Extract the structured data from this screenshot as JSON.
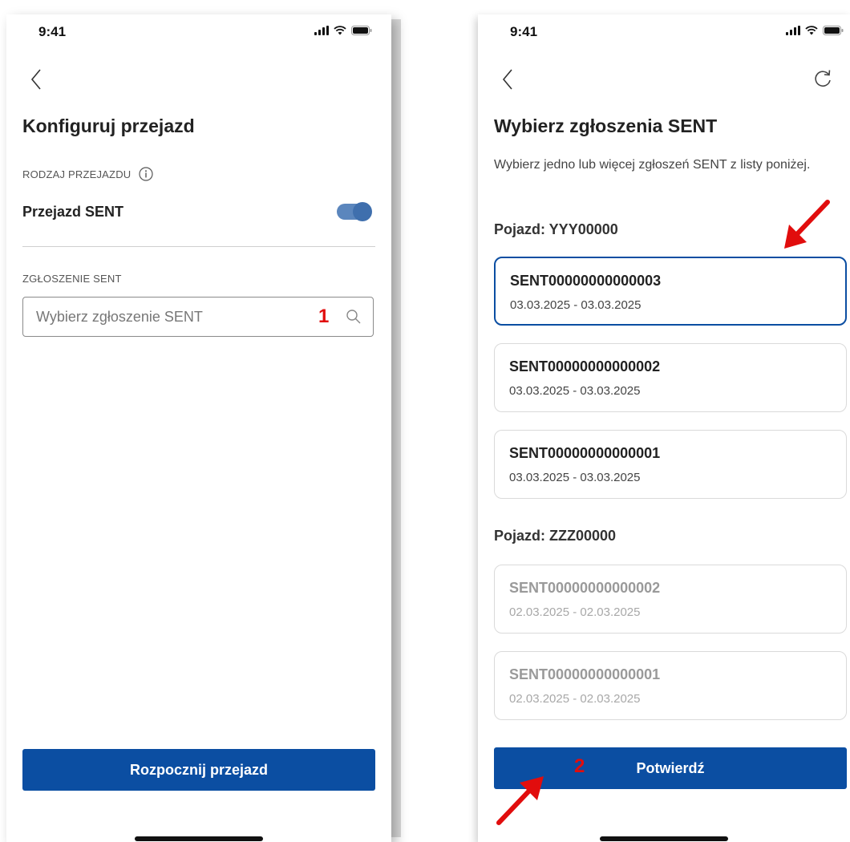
{
  "status_bar": {
    "time": "9:41"
  },
  "left_screen": {
    "title": "Konfiguruj przejazd",
    "ride_type_label": "RODZAJ PRZEJAZDU",
    "ride_type_value": "Przejazd SENT",
    "toggle_on": true,
    "sent_label": "ZGŁOSZENIE SENT",
    "search_placeholder": "Wybierz zgłoszenie SENT",
    "annotation": "1",
    "start_button": "Rozpocznij przejazd"
  },
  "right_screen": {
    "title": "Wybierz zgłoszenia SENT",
    "description": "Wybierz jedno lub więcej zgłoszeń SENT z listy poniżej.",
    "groups": [
      {
        "vehicle": "Pojazd: YYY00000",
        "items": [
          {
            "id": "SENT00000000000003",
            "dates": "03.03.2025 - 03.03.2025",
            "state": "selected"
          },
          {
            "id": "SENT00000000000002",
            "dates": "03.03.2025 - 03.03.2025",
            "state": "normal"
          },
          {
            "id": "SENT00000000000001",
            "dates": "03.03.2025 - 03.03.2025",
            "state": "normal"
          }
        ]
      },
      {
        "vehicle": "Pojazd: ZZZ00000",
        "items": [
          {
            "id": "SENT00000000000002",
            "dates": "02.03.2025 - 02.03.2025",
            "state": "disabled"
          },
          {
            "id": "SENT00000000000001",
            "dates": "02.03.2025 - 02.03.2025",
            "state": "disabled"
          }
        ]
      }
    ],
    "confirm_button": "Potwierdź",
    "annotation": "2"
  },
  "colors": {
    "primary": "#0b4ea2",
    "toggle": "#5b86bd",
    "annotation_red": "#e10d0d",
    "disabled_text": "#9a9a9a"
  },
  "icons": [
    "back-chevron-icon",
    "refresh-icon",
    "info-icon",
    "search-icon",
    "signal-icon",
    "wifi-icon",
    "battery-icon",
    "arrow-annotation-icon"
  ]
}
